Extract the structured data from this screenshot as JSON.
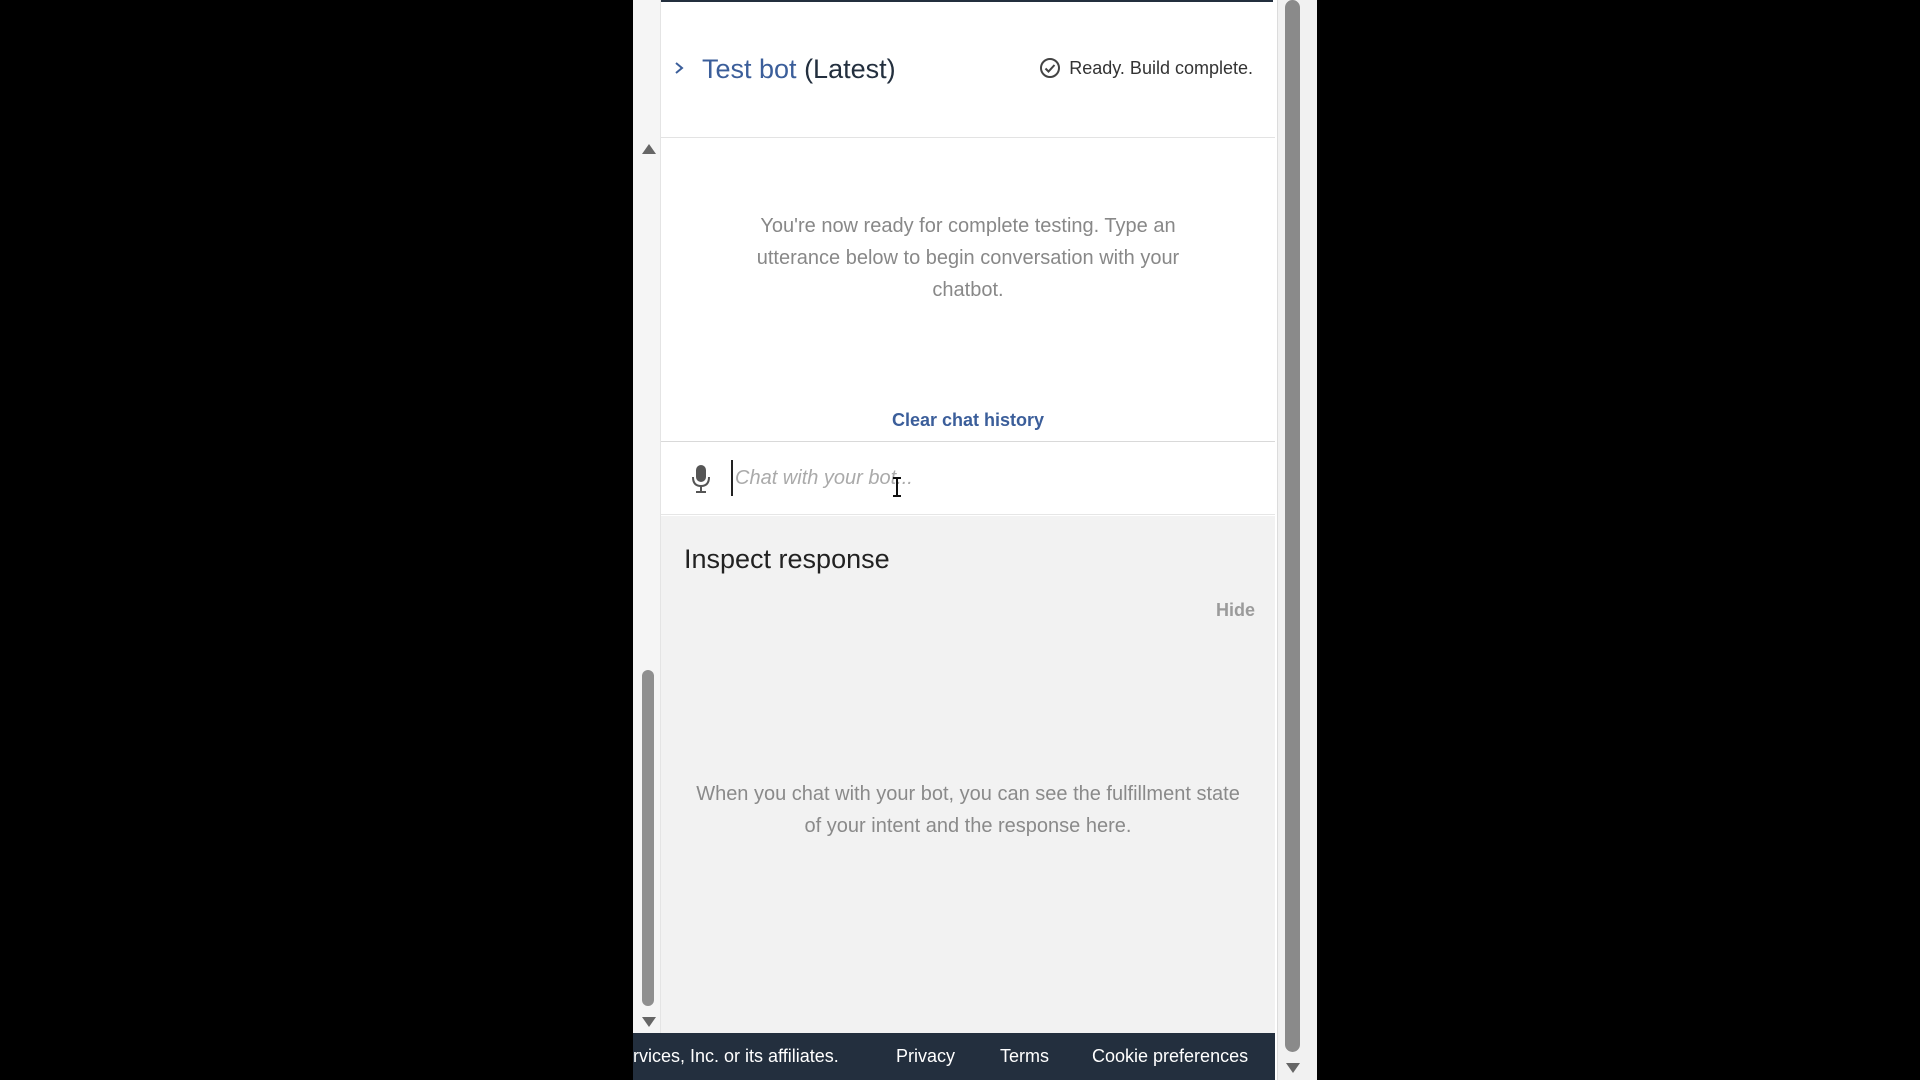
{
  "header": {
    "title_link": "Test bot",
    "title_suffix": " (Latest)",
    "status": "Ready. Build complete."
  },
  "chat": {
    "empty_message": "You're now ready for complete testing. Type an utterance below to begin conversation with your chatbot.",
    "clear_label": "Clear chat history",
    "input_placeholder": "Chat with your bot..."
  },
  "inspect": {
    "title": "Inspect response",
    "hide_label": "Hide",
    "empty_message": "When you chat with your bot, you can see the fulfillment state of your intent and the response here."
  },
  "footer": {
    "copyright": "rvices, Inc. or its affiliates.",
    "links": [
      "Privacy",
      "Terms",
      "Cookie preferences"
    ]
  },
  "colors": {
    "accent": "#3b5e9a",
    "footer_bg": "#232f3e",
    "inspect_bg": "#f2f2f2"
  },
  "icons": {
    "expand": "chevron-right-icon",
    "status": "check-circle-icon",
    "mic": "microphone-icon"
  }
}
